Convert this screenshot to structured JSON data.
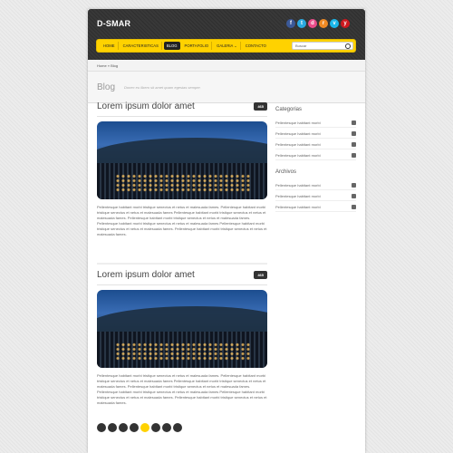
{
  "header": {
    "logo": "D-SMAR"
  },
  "social": [
    "facebook-icon",
    "twitter-icon",
    "dribbble-icon",
    "rss-icon",
    "vimeo-icon",
    "youtube-icon"
  ],
  "nav": {
    "items": [
      "HOME",
      "CARACTERISTICAS",
      "BLOG",
      "PORTAFOLIO",
      "GALERIA ⌄",
      "CONTACTO"
    ],
    "active": "BLOG",
    "search_placeholder": "Buscar"
  },
  "breadcrumb": "Home  »  Blog",
  "title": {
    "main": "Blog",
    "subtitle": "Donec eu libero sit amet quam egestas semper."
  },
  "posts": [
    {
      "title": "Lorem ipsum dolor amet",
      "badge": "465",
      "text": "Pellentesque habitant morbi tristique senectus et netus et malesuada fames. Pellentesque habitant morbi tristique senectus et netus et malesuada fames Pellentesque habitant morbi tristique senectus et netus et malesuada fames. Pellentesque habitant morbi tristique senectus et netus et malesuada fames. Pellentesque habitant morbi tristique senectus et netus et malesuada fames Pellentesque habitant morbi tristique senectus et netus et malesuada fames. Pellentesque habitant morbi tristique senectus et netus et malesuada fames."
    },
    {
      "title": "Lorem ipsum dolor amet",
      "badge": "465",
      "text": "Pellentesque habitant morbi tristique senectus et netus et malesuada fames. Pellentesque habitant morbi tristique senectus et netus et malesuada fames Pellentesque habitant morbi tristique senectus et netus et malesuada fames. Pellentesque habitant morbi tristique senectus et netus et malesuada fames. Pellentesque habitant morbi tristique senectus et netus et malesuada fames Pellentesque habitant morbi tristique senectus et netus et malesuada fames. Pellentesque habitant morbi tristique senectus et netus et malesuada fames."
    }
  ],
  "sidebar": {
    "categories_title": "Categorias",
    "categories": [
      "Pellentesque habitant morbi",
      "Pellentesque habitant morbi",
      "Pellentesque habitant morbi",
      "Pellentesque habitant morbi"
    ],
    "archives_title": "Archivos",
    "archives": [
      "Pellentesque habitant morbi",
      "Pellentesque habitant morbi",
      "Pellentesque habitant morbi"
    ]
  },
  "pager": {
    "current_index": 4,
    "count": 8
  },
  "colors": {
    "accent": "#ffd200",
    "dark": "#333333"
  }
}
